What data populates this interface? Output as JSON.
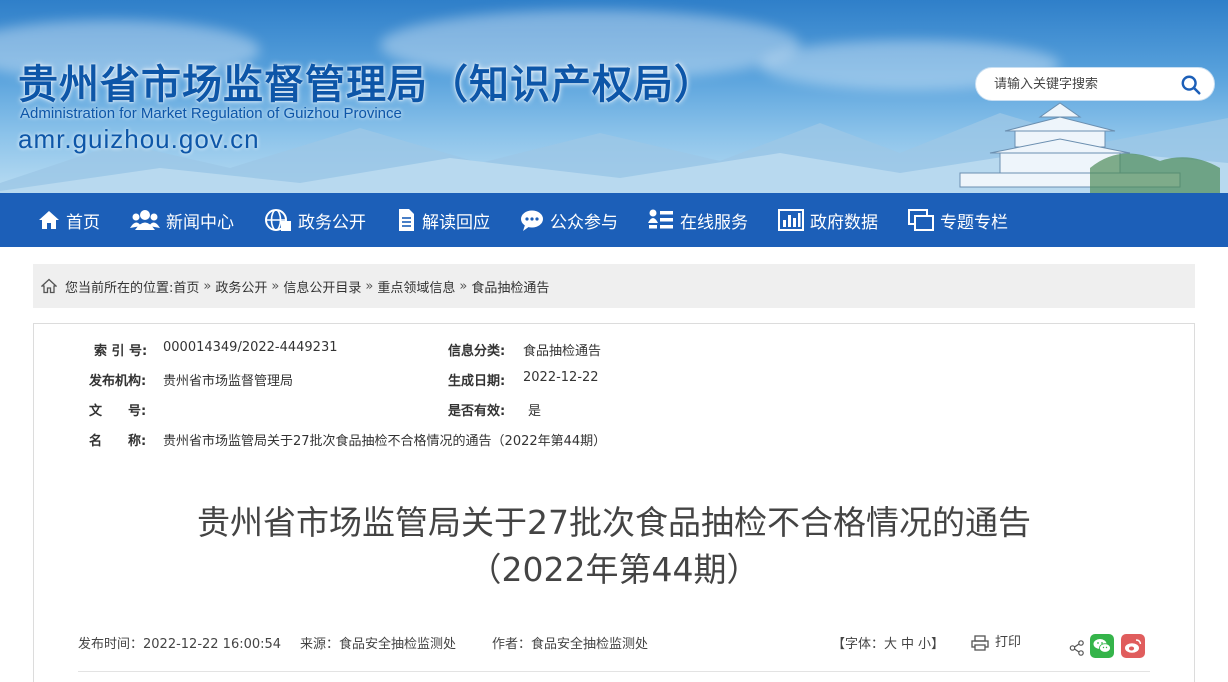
{
  "header": {
    "title": "贵州省市场监督管理局（知识产权局）",
    "title_en": "Administration for Market Regulation of Guizhou Province",
    "domain": "amr.guizhou.gov.cn",
    "search_placeholder": "请输入关键字搜索"
  },
  "nav": [
    {
      "label": "首页",
      "icon": "home-icon"
    },
    {
      "label": "新闻中心",
      "icon": "people-icon"
    },
    {
      "label": "政务公开",
      "icon": "globe-icon"
    },
    {
      "label": "解读回应",
      "icon": "document-icon"
    },
    {
      "label": "公众参与",
      "icon": "chat-icon"
    },
    {
      "label": "在线服务",
      "icon": "list-icon"
    },
    {
      "label": "政府数据",
      "icon": "bar-chart-icon"
    },
    {
      "label": "专题专栏",
      "icon": "windows-icon"
    }
  ],
  "breadcrumb": {
    "prefix": "您当前所在的位置:",
    "items": [
      "首页",
      "政务公开",
      "信息公开目录",
      "重点领域信息",
      "食品抽检通告"
    ]
  },
  "meta": {
    "index_label": "索 引 号:",
    "index_value": "000014349/2022-4449231",
    "category_label": "信息分类:",
    "category_value": "食品抽检通告",
    "publisher_label": "发布机构:",
    "publisher_value": "贵州省市场监督管理局",
    "date_label": "生成日期:",
    "date_value": "2022-12-22",
    "docno_label": "文　　号:",
    "docno_value": "",
    "valid_label": "是否有效:",
    "valid_value": "是",
    "name_label": "名　　称:",
    "name_value": "贵州省市场监管局关于27批次食品抽检不合格情况的通告（2022年第44期）"
  },
  "article": {
    "title_line1": "贵州省市场监管局关于27批次食品抽检不合格情况的通告",
    "title_line2": "（2022年第44期）",
    "publish_time": "发布时间：2022-12-22 16:00:54",
    "source": "来源：食品安全抽检监测处",
    "author": "作者：食品安全抽检监测处",
    "font_size_prefix": "【字体：",
    "font_large": "大",
    "font_medium": "中",
    "font_small": "小",
    "font_size_suffix": "】",
    "print_label": "打印"
  },
  "colors": {
    "nav_bg": "#1c5fb8",
    "title_blue": "#0d56a8",
    "wechat_green": "#35b44a",
    "weibo_red": "#e05d5d"
  }
}
